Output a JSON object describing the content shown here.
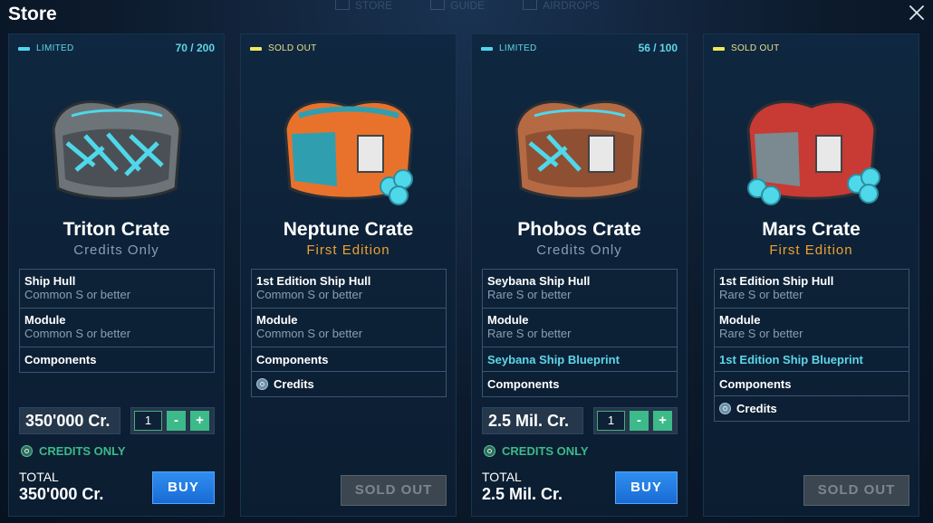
{
  "window": {
    "title": "Store",
    "background_nav": [
      "STORE",
      "GUIDE",
      "AIRDROPS"
    ]
  },
  "cards": [
    {
      "tag": "LIMITED",
      "stock": "70 / 200",
      "name": "Triton Crate",
      "subtitle": "Credits Only",
      "contents": [
        {
          "title": "Ship Hull",
          "sub": "Common S or better"
        },
        {
          "title": "Module",
          "sub": "Common S or better"
        },
        {
          "title": "Components"
        }
      ],
      "price": "350'000 Cr.",
      "quantity": "1",
      "minus": "-",
      "plus": "+",
      "credits_only": "CREDITS ONLY",
      "total_label": "TOTAL",
      "total": "350'000 Cr.",
      "action": "BUY"
    },
    {
      "tag": "SOLD OUT",
      "name": "Neptune Crate",
      "subtitle": "First Edition",
      "contents": [
        {
          "title": "1st Edition Ship Hull",
          "sub": "Common S or better"
        },
        {
          "title": "Module",
          "sub": "Common S or better"
        },
        {
          "title": "Components"
        },
        {
          "title": "Credits"
        }
      ],
      "action": "SOLD OUT"
    },
    {
      "tag": "LIMITED",
      "stock": "56 / 100",
      "name": "Phobos Crate",
      "subtitle": "Credits Only",
      "contents": [
        {
          "title": "Seybana Ship Hull",
          "sub": "Rare S or better"
        },
        {
          "title": "Module",
          "sub": "Rare S or better"
        },
        {
          "title": "Seybana Ship Blueprint"
        },
        {
          "title": "Components"
        }
      ],
      "price": "2.5 Mil. Cr.",
      "quantity": "1",
      "minus": "-",
      "plus": "+",
      "credits_only": "CREDITS ONLY",
      "total_label": "TOTAL",
      "total": "2.5 Mil. Cr.",
      "action": "BUY"
    },
    {
      "tag": "SOLD OUT",
      "name": "Mars Crate",
      "subtitle": "First Edition",
      "contents": [
        {
          "title": "1st Edition Ship Hull",
          "sub": "Rare S or better"
        },
        {
          "title": "Module",
          "sub": "Rare S or better"
        },
        {
          "title": "1st Edition Ship Blueprint"
        },
        {
          "title": "Components"
        },
        {
          "title": "Credits"
        }
      ],
      "action": "SOLD OUT"
    }
  ],
  "colors": {
    "limited": "#4fd7ea",
    "sold_out": "#f0e85a",
    "first_edition": "#f0a030",
    "credits_green": "#3cba8a",
    "buy_blue": "#1a6bd4",
    "blueprint_cyan": "#5fd6e8"
  },
  "icons": [
    "close-icon",
    "credits-coin-icon",
    "crate-image"
  ]
}
